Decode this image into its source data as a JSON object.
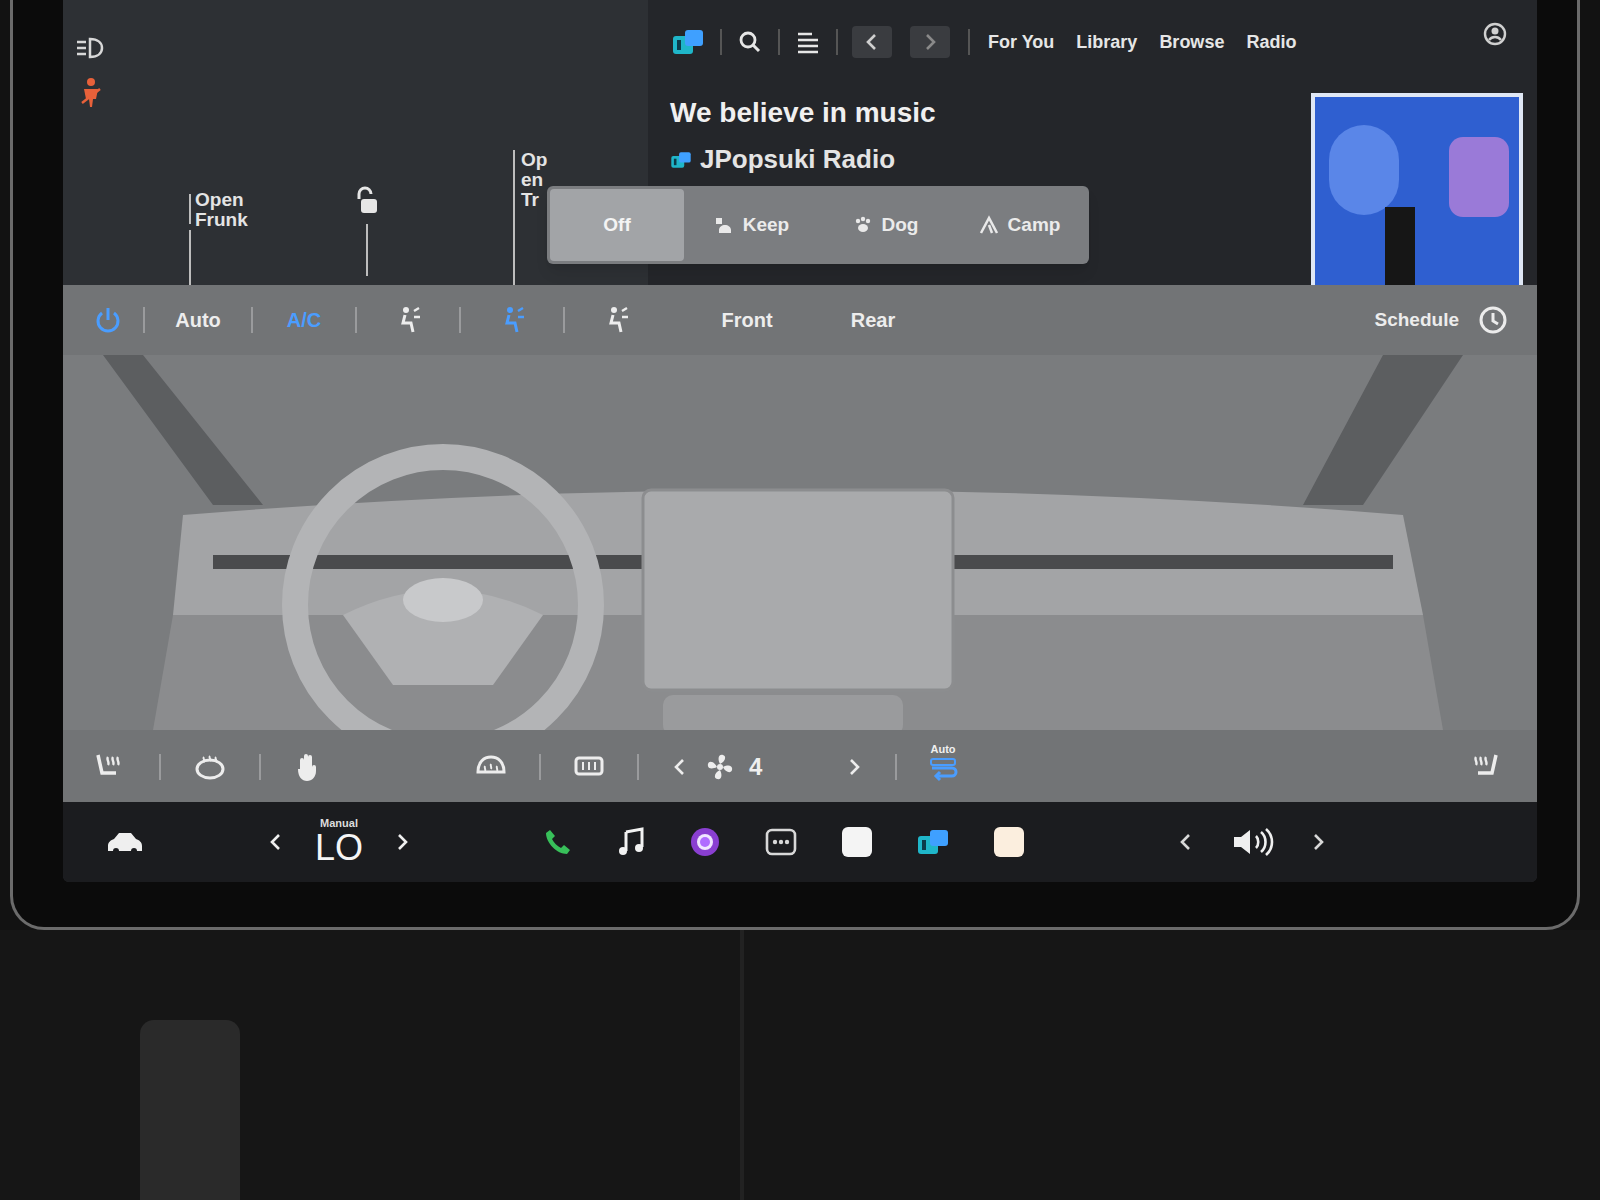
{
  "vehicle": {
    "frunk_label": "Open Frunk",
    "trunk_label": "Open Tr"
  },
  "camp_modes": [
    {
      "label": "Off",
      "selected": true
    },
    {
      "label": "Keep",
      "selected": false
    },
    {
      "label": "Dog",
      "selected": false
    },
    {
      "label": "Camp",
      "selected": false
    }
  ],
  "media": {
    "nav_tabs": [
      {
        "label": "For You"
      },
      {
        "label": "Library"
      },
      {
        "label": "Browse"
      },
      {
        "label": "Radio"
      }
    ],
    "title": "We believe in music",
    "station": "JPopsuki Radio"
  },
  "climate": {
    "power_on": true,
    "auto": {
      "label": "Auto",
      "selected": false
    },
    "ac": {
      "label": "A/C",
      "selected": true
    },
    "airflow": [
      {
        "selected": false
      },
      {
        "selected": true
      },
      {
        "selected": false
      }
    ],
    "zones": [
      {
        "label": "Front",
        "selected": false
      },
      {
        "label": "Rear",
        "selected": false
      }
    ],
    "schedule_label": "Schedule",
    "fan_speed": "4",
    "recirculation": {
      "label": "Auto",
      "selected": true
    }
  },
  "taskbar": {
    "temperature_mode": "Manual",
    "temperature": "LO"
  }
}
